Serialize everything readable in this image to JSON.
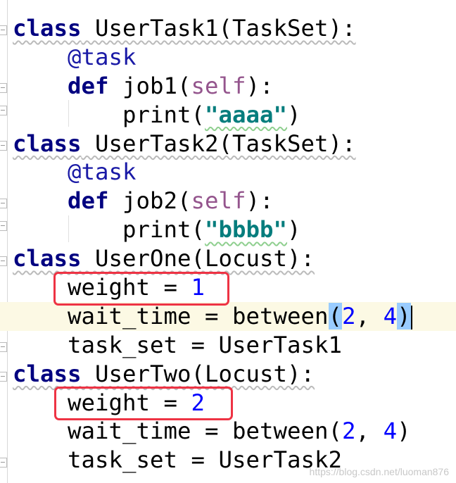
{
  "editor": {
    "current_line": 10,
    "colors": {
      "keyword": "#000080",
      "decorator": "#1a1aa6",
      "self": "#94558d",
      "string": "#067d7d",
      "number": "#0000ff",
      "highlight_box": "#ee3344",
      "current_line": "#fcf9e4"
    },
    "lines": [
      {
        "tokens": [
          {
            "t": "class",
            "c": "kw wavy"
          },
          {
            "t": " UserTask1(TaskSet):",
            "c": "wavy"
          }
        ]
      },
      {
        "tokens": [
          {
            "t": "    "
          },
          {
            "t": "@task",
            "c": "dec"
          }
        ]
      },
      {
        "tokens": [
          {
            "t": "    "
          },
          {
            "t": "def",
            "c": "kw"
          },
          {
            "t": " job1("
          },
          {
            "t": "self",
            "c": "self"
          },
          {
            "t": "):"
          }
        ]
      },
      {
        "tokens": [
          {
            "t": "        print("
          },
          {
            "t": "\"aaaa\"",
            "c": "str wavyg"
          },
          {
            "t": ")"
          }
        ]
      },
      {
        "tokens": [
          {
            "t": "class",
            "c": "kw wavy"
          },
          {
            "t": " UserTask2(TaskSet):",
            "c": "wavy"
          }
        ]
      },
      {
        "tokens": [
          {
            "t": "    "
          },
          {
            "t": "@task",
            "c": "dec"
          }
        ]
      },
      {
        "tokens": [
          {
            "t": "    "
          },
          {
            "t": "def",
            "c": "kw"
          },
          {
            "t": " job2("
          },
          {
            "t": "self",
            "c": "self"
          },
          {
            "t": "):"
          }
        ]
      },
      {
        "tokens": [
          {
            "t": "        print("
          },
          {
            "t": "\"bbbb\"",
            "c": "str wavyg"
          },
          {
            "t": ")"
          }
        ]
      },
      {
        "tokens": [
          {
            "t": "class",
            "c": "kw wavy"
          },
          {
            "t": " UserOne(Locust):",
            "c": "wavy"
          }
        ]
      },
      {
        "tokens": [
          {
            "t": "    weight = "
          },
          {
            "t": "1",
            "c": "num"
          }
        ]
      },
      {
        "tokens": [
          {
            "t": "    wait_time = between"
          },
          {
            "t": "(",
            "c": "brace"
          },
          {
            "t": "2",
            "c": "num"
          },
          {
            "t": ", "
          },
          {
            "t": "4",
            "c": "num"
          },
          {
            "t": ")",
            "c": "brace"
          }
        ]
      },
      {
        "tokens": [
          {
            "t": "    task_set = UserTask1"
          }
        ]
      },
      {
        "tokens": [
          {
            "t": "class",
            "c": "kw wavy"
          },
          {
            "t": " UserTwo(Locust):",
            "c": "wavy"
          }
        ]
      },
      {
        "tokens": [
          {
            "t": "    weight = "
          },
          {
            "t": "2",
            "c": "num"
          }
        ]
      },
      {
        "tokens": [
          {
            "t": "    wait_time = between("
          },
          {
            "t": "2",
            "c": "num"
          },
          {
            "t": ", "
          },
          {
            "t": "4",
            "c": "num"
          },
          {
            "t": ")"
          }
        ]
      },
      {
        "tokens": [
          {
            "t": "    task_set = UserTask2"
          }
        ]
      }
    ]
  },
  "watermark": "https://blog.csdn.net/luoman876"
}
